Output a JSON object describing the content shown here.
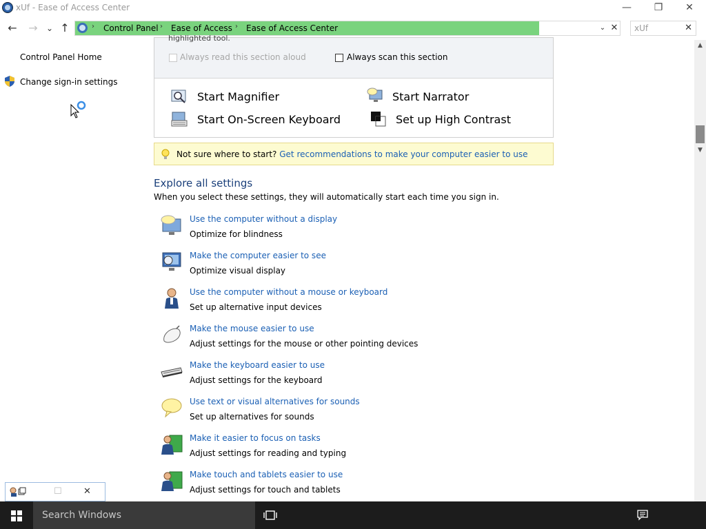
{
  "window": {
    "title": "xUf - Ease of Access Center",
    "controls": {
      "minimize": "—",
      "maximize": "❐",
      "close": "✕"
    }
  },
  "nav": {
    "back": "←",
    "forward": "→",
    "recent": "⌄",
    "up": "↑",
    "breadcrumbs": [
      "Control Panel",
      "Ease of Access",
      "Ease of Access Center"
    ],
    "separator": "›",
    "dropdown": "⌄",
    "clear": "✕",
    "search_value": "xUf",
    "search_clear": "✕"
  },
  "sidebar": {
    "home": "Control Panel Home",
    "signin": "Change sign-in settings"
  },
  "quick": {
    "cut_heading": "highlighted tool.",
    "cb_read_aloud": "Always read this section aloud",
    "cb_scan": "Always scan this section",
    "items": [
      {
        "label": "Start Magnifier",
        "icon": "magnifier-icon"
      },
      {
        "label": "Start Narrator",
        "icon": "narrator-icon"
      },
      {
        "label": "Start On-Screen Keyboard",
        "icon": "onscreen-keyboard-icon"
      },
      {
        "label": "Set up High Contrast",
        "icon": "high-contrast-icon"
      }
    ]
  },
  "tip": {
    "prefix": "Not sure where to start?",
    "link": "Get recommendations to make your computer easier to use"
  },
  "explore": {
    "heading": "Explore all settings",
    "subtitle": "When you select these settings, they will automatically start each time you sign in.",
    "items": [
      {
        "title": "Use the computer without a display",
        "desc": "Optimize for blindness",
        "icon": "monitor-speech-icon"
      },
      {
        "title": "Make the computer easier to see",
        "desc": "Optimize visual display",
        "icon": "monitor-icon"
      },
      {
        "title": "Use the computer without a mouse or keyboard",
        "desc": "Set up alternative input devices",
        "icon": "person-icon"
      },
      {
        "title": "Make the mouse easier to use",
        "desc": "Adjust settings for the mouse or other pointing devices",
        "icon": "mouse-icon"
      },
      {
        "title": "Make the keyboard easier to use",
        "desc": "Adjust settings for the keyboard",
        "icon": "keyboard-icon"
      },
      {
        "title": "Use text or visual alternatives for sounds",
        "desc": "Set up alternatives for sounds",
        "icon": "speech-bubble-icon"
      },
      {
        "title": "Make it easier to focus on tasks",
        "desc": "Adjust settings for reading and typing",
        "icon": "person-focus-icon"
      },
      {
        "title": "Make touch and tablets easier to use",
        "desc": "Adjust settings for touch and tablets",
        "icon": "person-touch-icon"
      }
    ]
  },
  "taskbar": {
    "search_placeholder": "Search Windows"
  },
  "colors": {
    "link": "#1a5fb4",
    "breadcrumb_bg": "#7ad37e",
    "tip_bg": "#fdfbd1",
    "taskbar": "#1c1c1c"
  }
}
